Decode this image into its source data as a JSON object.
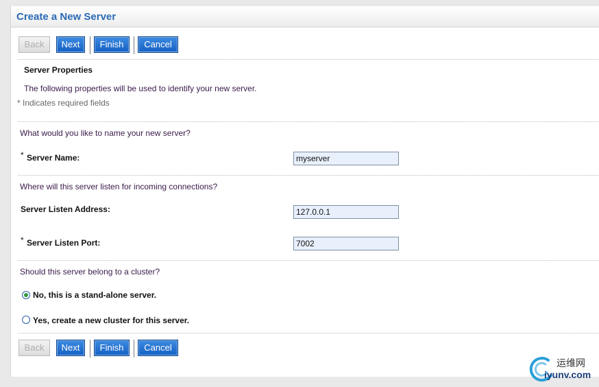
{
  "header": {
    "title": "Create a New Server"
  },
  "buttons": {
    "back": "Back",
    "next": "Next",
    "finish": "Finish",
    "cancel": "Cancel"
  },
  "section": {
    "title": "Server Properties",
    "description": "The following properties will be used to identify your new server.",
    "required_note": "* Indicates required fields"
  },
  "name_group": {
    "question": "What would you like to name your new server?",
    "server_name_label": "Server Name:",
    "server_name_value": "myserver"
  },
  "listen_group": {
    "question": "Where will this server listen for incoming connections?",
    "address_label": "Server Listen Address:",
    "address_value": "127.0.0.1",
    "port_label": "Server Listen Port:",
    "port_value": "7002"
  },
  "cluster_group": {
    "question": "Should this server belong to a cluster?",
    "option_standalone": "No, this is a stand-alone server.",
    "option_new_cluster": "Yes, create a new cluster for this server.",
    "selected": "standalone"
  },
  "required_marker": "*",
  "watermark": {
    "cn": "运维网",
    "domain": "iyunv.com"
  },
  "colors": {
    "title_blue": "#2a6ab4",
    "button_blue": "#1560c4",
    "input_bg": "#e8f0fb",
    "radio_selected": "#2e9a3a"
  }
}
